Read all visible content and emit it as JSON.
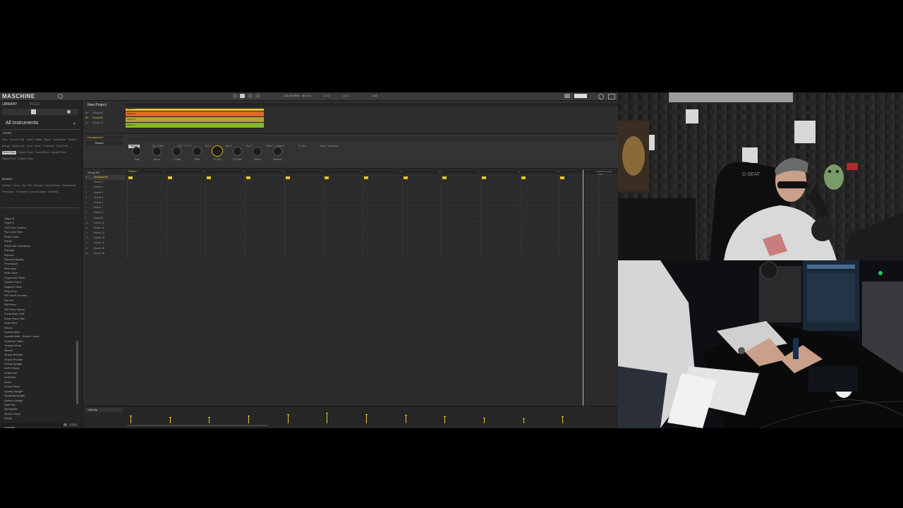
{
  "app": {
    "name": "MASCHINE",
    "project_title": "New Project",
    "transport": {
      "tempo": "120.00 BPM",
      "swing": "50.0 %",
      "signature": "4 / 4",
      "position": "1:1:1",
      "grid": "1/16"
    }
  },
  "browser": {
    "tab_library": "LIBRARY",
    "tab_files": "FILES",
    "category": "All Instruments",
    "types_header": "TYPES",
    "type_tags": [
      "Bass",
      "Drums & Hits",
      "Guitar",
      "Mallet",
      "Organ",
      "Piano/Keys",
      "Plucked",
      "Strings",
      "Synth Lead",
      "Vocal",
      "Brass",
      "Ensemble",
      "Synth Pad",
      "Piano Keys",
      "Electric Piano",
      "Grand Piano",
      "Upright Piano",
      "Digital Piano",
      "Classic Piano"
    ],
    "selected_type": "Piano Keys",
    "modes_header": "MODES",
    "mode_tags": [
      "Additive",
      "Chord",
      "Dry",
      "FM",
      "Granular",
      "Long Release",
      "Monophonic",
      "Percussive",
      "Processed",
      "Sample-based",
      "Synthetic"
    ],
    "presets": [
      "Organ B",
      "Organ C",
      "Out in the Cosmos",
      "Pan Cake Keys",
      "Pedal Tones",
      "Pianet",
      "Pianet MK Overdriven",
      "Pianette",
      "Pianoid",
      "Pianovid Myway",
      "Percussion",
      "Pink Haze",
      "Pluck Style",
      "Polyphonic Piano",
      "Quantic Poly 1",
      "Ragtime Piano",
      "Ring of Ice",
      "RM Home Acoustic",
      "RM Lofi",
      "RM Piano",
      "RM Piano Secret",
      "Rocky Bass Split",
      "Rosie Piano Vibe",
      "Rose Mary",
      "Saloon",
      "Scarlett Walk",
      "Scarlett Walk - Stretch Tuned",
      "Scattered Vibes",
      "Shaped Wood",
      "Sitarmi",
      "Simple Rhodes",
      "Simple Rhodes",
      "Smoky Upright",
      "Soft E-Piano",
      "Smilemore",
      "Soft Eyes",
      "Smell",
      "Sound Piano",
      "Sparkly Upright",
      "Sparkling Upright",
      "Spheric Upright",
      "Split Pad",
      "Springletter",
      "Steel & Stone",
      "Storey",
      "Stolen Memories",
      "Sunbase"
    ]
  },
  "arranger": {
    "groups": [
      {
        "id": "A1",
        "name": "Group A1"
      },
      {
        "id": "B1",
        "name": "Group B1"
      },
      {
        "id": "C1",
        "name": "Group C1"
      }
    ],
    "scene_label": "Scene 1",
    "clips": [
      {
        "label": "Pattern 1",
        "color": "#d9682a"
      },
      {
        "label": "Pattern 1",
        "color": "#b7a03a"
      },
      {
        "label": "Pattern 1",
        "color": "#86b535"
      }
    ]
  },
  "control": {
    "slot_label": "Unorganized",
    "master_label": "Master",
    "page_tabs": [
      "Sound",
      "EQ + Filter",
      "FX 1 + FX 2",
      "Env 1",
      "Env 2",
      "Env 3",
      "Filter 1 + Filter 2",
      "FX Mix",
      "Amp + Envelope"
    ],
    "knobs": [
      {
        "label": "Tune",
        "active": false
      },
      {
        "label": "Damp",
        "active": false
      },
      {
        "label": "Cutoff",
        "active": false
      },
      {
        "label": "Filter",
        "active": false
      },
      {
        "label": "FX Mix",
        "active": true
      },
      {
        "label": "FX Rate",
        "active": false
      },
      {
        "label": "Attack",
        "active": false
      },
      {
        "label": "Release",
        "active": false
      }
    ]
  },
  "pattern_editor": {
    "group_label": "Group B1",
    "pattern_label": "Pattern 1",
    "pattern_length_label": "Pattern Length: 4:0:0",
    "sounds": [
      "Unorganized",
      "Sound 2",
      "Sound 3",
      "Sound 4",
      "Sound 5",
      "Sound 6",
      "Sound 7",
      "Sound 8",
      "Sound 9",
      "Sound 10",
      "Sound 11",
      "Sound 12",
      "Sound 13",
      "Sound 14",
      "Sound 15",
      "Sound 16"
    ],
    "ruler": [
      "1",
      "1.2",
      "1.3",
      "1.4",
      "2",
      "2.2",
      "2.3",
      "2.4",
      "3",
      "3.2",
      "3.3",
      "3.4",
      "4"
    ],
    "note_steps": [
      0,
      1,
      2,
      3,
      4,
      5,
      6,
      7,
      8,
      9,
      10,
      11
    ],
    "velocities": [
      0.5,
      0.4,
      0.4,
      0.5,
      0.6,
      0.7,
      0.6,
      0.55,
      0.45,
      0.35,
      0.3,
      0.45
    ],
    "velocity_label": "Velocity"
  },
  "webcam": {
    "top_label": "D-SEAT",
    "bottom_scene": "studio desk"
  }
}
